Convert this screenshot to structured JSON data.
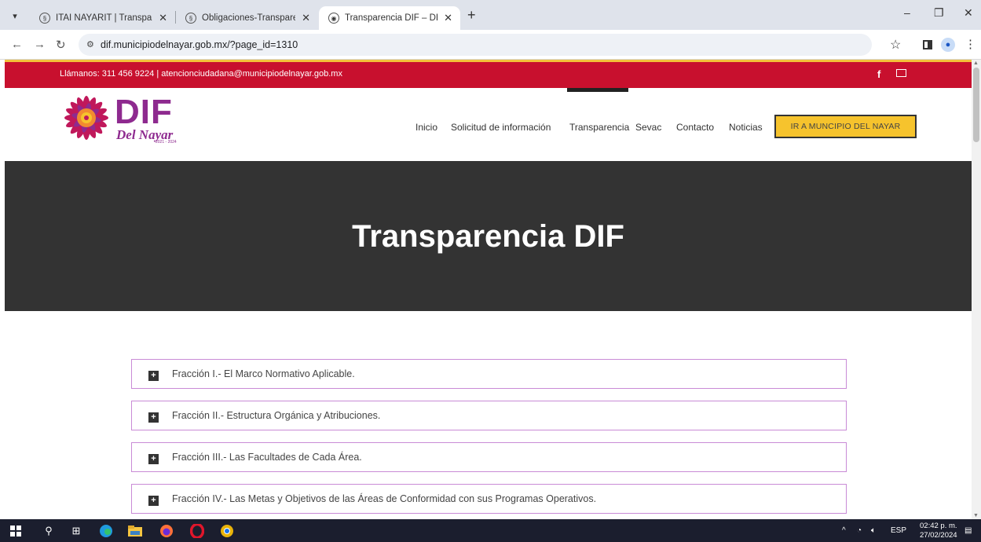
{
  "browser": {
    "tabs": [
      {
        "label": "ITAI NAYARIT | Transparencia",
        "active": false
      },
      {
        "label": "Obligaciones-Transparencia | IT",
        "active": false
      },
      {
        "label": "Transparencia DIF – DIF Municip",
        "active": true
      }
    ],
    "url": "dif.municipiodelnayar.gob.mx/?page_id=1310"
  },
  "site": {
    "contact_text": "Llámanos: 311 456 9224 | atencionciudadana@municipiodelnayar.gob.mx",
    "social": {
      "facebook": "f"
    },
    "logo": {
      "main": "DIF",
      "sub": "Del Nayar",
      "years": "2021 - 2024"
    },
    "menu": [
      "Inicio",
      "Solicitud de información",
      "Transparencia",
      "Sevac",
      "Contacto",
      "Noticias"
    ],
    "cta_label": "IR A MUNCIPIO DEL NAYAR",
    "hero_title": "Transparencia DIF",
    "accordion": [
      "Fracción I.- El Marco Normativo Aplicable.",
      "Fracción II.- Estructura Orgánica y Atribuciones.",
      "Fracción III.- Las Facultades de Cada Área.",
      "Fracción IV.- Las Metas y Objetivos de las Áreas de Conformidad con sus Programas Operativos."
    ]
  },
  "taskbar": {
    "language": "ESP",
    "time": "02:42 p. m.",
    "date": "27/02/2024"
  },
  "colors": {
    "topbar": "#c8102e",
    "hero": "#333333",
    "cta": "#f6c32d",
    "accordion_border": "#c98bd6",
    "brand_purple": "#8e2a8f"
  }
}
